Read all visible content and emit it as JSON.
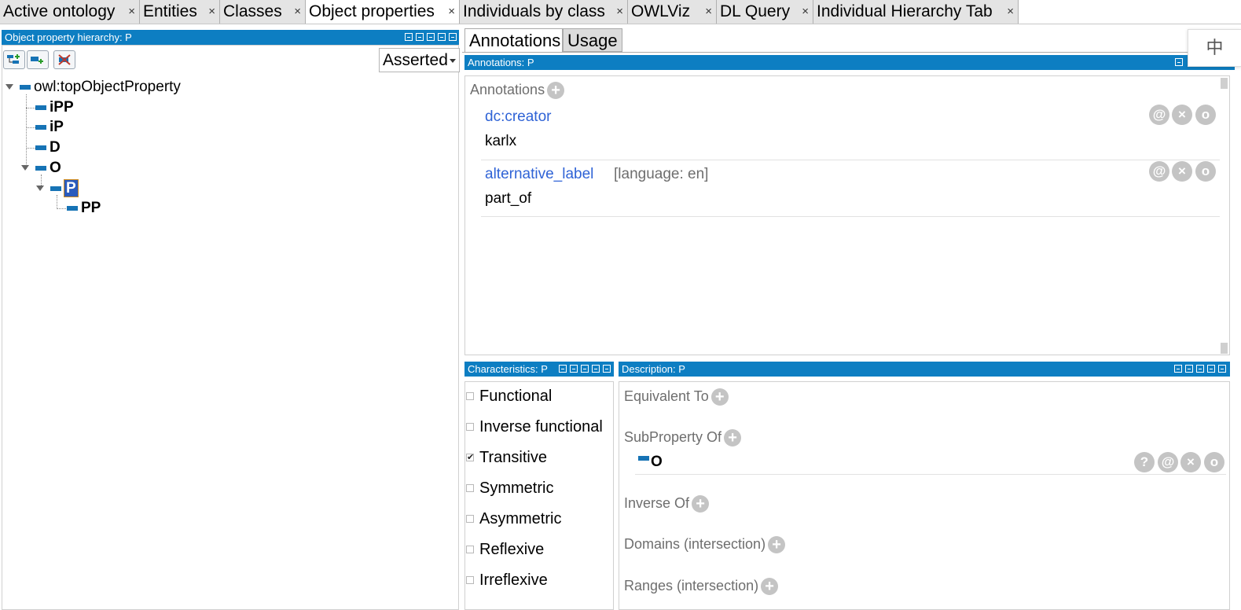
{
  "tabs": [
    {
      "label": "Active ontology",
      "close": "×"
    },
    {
      "label": "Entities",
      "close": "×"
    },
    {
      "label": "Classes",
      "close": "×"
    },
    {
      "label": "Object properties",
      "close": "×"
    },
    {
      "label": "Individuals by class",
      "close": "×"
    },
    {
      "label": "OWLViz",
      "close": "×"
    },
    {
      "label": "DL Query",
      "close": "×"
    },
    {
      "label": "Individual Hierarchy Tab",
      "close": "×"
    }
  ],
  "active_tab": "Object properties",
  "hierarchy": {
    "title": "Object property hierarchy: P",
    "mode": "Asserted",
    "tree": {
      "root": "owl:topObjectProperty",
      "n1": "iPP",
      "n2": "iP",
      "n3": "D",
      "n4": "O",
      "n5": "P",
      "n6": "PP"
    },
    "toolbar_icons": [
      "add-subproperty-icon",
      "add-sibling-property-icon",
      "delete-property-icon"
    ]
  },
  "ime_indicator": "中",
  "right_tabs": {
    "annotations": "Annotations",
    "usage": "Usage"
  },
  "annotations_view": {
    "title": "Annotations: P",
    "section": "Annotations",
    "items": [
      {
        "property": "dc:creator",
        "value": "karlx",
        "lang": ""
      },
      {
        "property": "alternative_label",
        "value": "part_of",
        "lang": "[language: en]"
      }
    ]
  },
  "characteristics": {
    "title": "Characteristics: P",
    "items": [
      {
        "label": "Functional",
        "checked": false
      },
      {
        "label": "Inverse functional",
        "checked": false
      },
      {
        "label": "Transitive",
        "checked": true
      },
      {
        "label": "Symmetric",
        "checked": false
      },
      {
        "label": "Asymmetric",
        "checked": false
      },
      {
        "label": "Reflexive",
        "checked": false
      },
      {
        "label": "Irreflexive",
        "checked": false
      }
    ],
    "check_mark": "✔"
  },
  "description": {
    "title": "Description: P",
    "equivalent_to": "Equivalent To",
    "subproperty_of": "SubProperty Of",
    "subproperty_value": "O",
    "inverse_of": "Inverse Of",
    "domains": "Domains (intersection)",
    "ranges": "Ranges (intersection)"
  },
  "icons": {
    "plus": "+",
    "at": "@",
    "delete": "×",
    "edit": "o",
    "help": "?"
  },
  "colors": {
    "header_blue": "#0d7ec2",
    "property_blue": "#1673b5",
    "link_blue": "#2f63d6",
    "selection": "#2a5bbd"
  }
}
